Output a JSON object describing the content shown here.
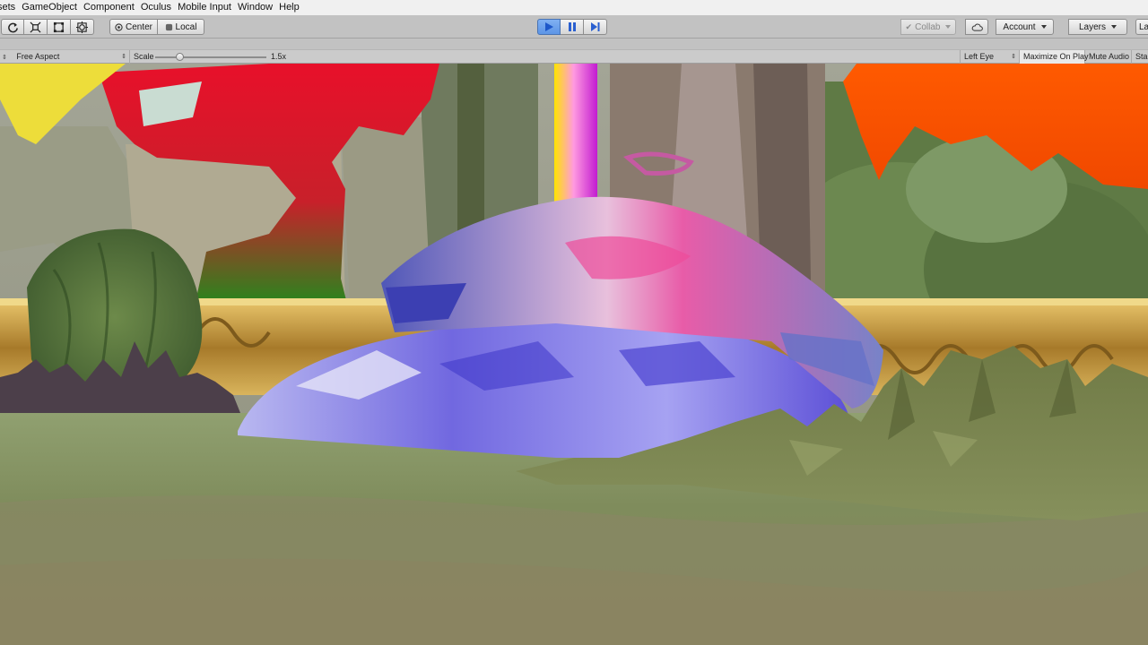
{
  "menu": [
    "sets",
    "GameObject",
    "Component",
    "Oculus",
    "Mobile Input",
    "Window",
    "Help"
  ],
  "toolbar": {
    "tools": [
      {
        "icon": "rotate-tool-icon"
      },
      {
        "icon": "scale-tool-icon"
      },
      {
        "icon": "rect-tool-icon"
      },
      {
        "icon": "transform-tool-icon"
      }
    ],
    "pivot_label": "Center",
    "space_label": "Local",
    "play": {
      "play_icon": "play-icon",
      "pause_icon": "pause-icon",
      "step_icon": "step-icon",
      "playing": true
    },
    "collab_label": "Collab",
    "cloud_icon": "cloud-icon",
    "account_label": "Account",
    "layers_label": "Layers",
    "layout_label": "La"
  },
  "game_view": {
    "aspect_label": "Free Aspect",
    "scale_label": "Scale",
    "scale_value": "1.5x",
    "eye_label": "Left Eye",
    "maximize_label": "Maximize On Play",
    "mute_label": "Mute Audio",
    "stats_label": "Sta"
  },
  "colors": {
    "play_active": "#5d95e6",
    "toolbar_bg": "#c2c2c2",
    "menubar_bg": "#f0f0f0"
  }
}
